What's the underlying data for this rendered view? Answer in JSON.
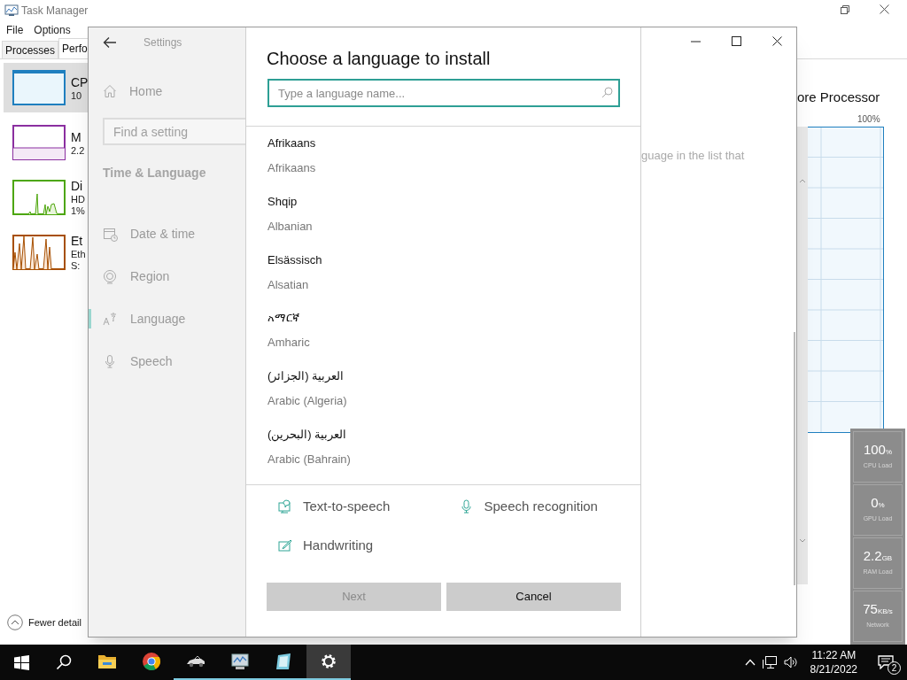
{
  "task_manager": {
    "title": "Task Manager",
    "menu": [
      "File",
      "Options"
    ],
    "tabs": [
      {
        "label": "Processes",
        "selected": false
      },
      {
        "label": "Perfo",
        "selected": true
      }
    ],
    "resources": [
      {
        "kind": "cpu",
        "lines": [
          "CP",
          "10"
        ],
        "color": "#1f7fbf",
        "selected": true
      },
      {
        "kind": "memory",
        "lines": [
          "M",
          "2.2"
        ],
        "color": "#8b2fa0",
        "selected": false
      },
      {
        "kind": "disk",
        "lines": [
          "Di",
          "HD",
          "1%"
        ],
        "color": "#4da60c",
        "selected": false
      },
      {
        "kind": "ethernet",
        "lines": [
          "Et",
          "Eth",
          "S:"
        ],
        "color": "#a74f01",
        "selected": false
      }
    ],
    "heading": "ore Processor",
    "graph_max": "100%",
    "fewer_details": "Fewer detail"
  },
  "settings": {
    "title": "Settings",
    "home": "Home",
    "search": {
      "placeholder": "Find a setting"
    },
    "section": "Time & Language",
    "nav": [
      {
        "kind": "calendar",
        "label": "Date & time",
        "selected": false
      },
      {
        "kind": "globe",
        "label": "Region",
        "selected": false
      },
      {
        "kind": "language",
        "label": "Language",
        "selected": true
      },
      {
        "kind": "microphone",
        "label": "Speech",
        "selected": false
      }
    ],
    "page_text": "guage in the list that"
  },
  "dialog": {
    "title": "Choose a language to install",
    "search": {
      "placeholder": "Type a language name..."
    },
    "languages": [
      {
        "native": "Afrikaans",
        "english": "Afrikaans"
      },
      {
        "native": "Shqip",
        "english": "Albanian"
      },
      {
        "native": "Elsässisch",
        "english": "Alsatian"
      },
      {
        "native": "አማርኛ",
        "english": "Amharic"
      },
      {
        "native": "العربية (الجزائر)",
        "english": "Arabic (Algeria)"
      },
      {
        "native": "العربية (البحرين)",
        "english": "Arabic (Bahrain)"
      }
    ],
    "features": [
      {
        "kind": "speech",
        "label": "Text-to-speech"
      },
      {
        "kind": "microphone",
        "label": "Speech recognition"
      },
      {
        "kind": "pen",
        "label": "Handwriting"
      }
    ],
    "buttons": [
      {
        "label": "Next",
        "disabled": true
      },
      {
        "label": "Cancel",
        "disabled": false
      }
    ]
  },
  "gadget": [
    {
      "value": "100",
      "unit": "%",
      "label": "CPU Load"
    },
    {
      "value": "0",
      "unit": "%",
      "label": "GPU Load"
    },
    {
      "value": "2.2",
      "unit": "GB",
      "label": "RAM Load"
    },
    {
      "value": "75",
      "unit": "KB/s",
      "label": "Network"
    }
  ],
  "taskbar": {
    "apps": [
      {
        "kind": "explorer",
        "running": false,
        "selected": false
      },
      {
        "kind": "chrome",
        "running": false,
        "selected": false
      },
      {
        "kind": "car",
        "running": true,
        "selected": false
      },
      {
        "kind": "monitor",
        "running": true,
        "selected": false
      },
      {
        "kind": "notepad",
        "running": true,
        "selected": false
      },
      {
        "kind": "gear",
        "running": true,
        "selected": true
      }
    ],
    "time": "11:22 AM",
    "date": "8/21/2022",
    "notifications": "2"
  }
}
